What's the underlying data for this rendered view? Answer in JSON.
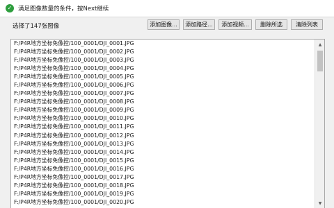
{
  "status": {
    "icon": "check-circle-icon",
    "text": "满足图像数量的条件，按Next继续"
  },
  "panel": {
    "count_label": "选择了147张图像",
    "buttons": {
      "add_images": "添加图像...",
      "add_path": "添加路径...",
      "add_video": "添加视频...",
      "remove_selected": "删除所选",
      "clear_list": "清除列表"
    },
    "file_list": [
      "F:/P4R地方坐标免像控/100_0001/DJI_0001.JPG",
      "F:/P4R地方坐标免像控/100_0001/DJI_0002.JPG",
      "F:/P4R地方坐标免像控/100_0001/DJI_0003.JPG",
      "F:/P4R地方坐标免像控/100_0001/DJI_0004.JPG",
      "F:/P4R地方坐标免像控/100_0001/DJI_0005.JPG",
      "F:/P4R地方坐标免像控/100_0001/DJI_0006.JPG",
      "F:/P4R地方坐标免像控/100_0001/DJI_0007.JPG",
      "F:/P4R地方坐标免像控/100_0001/DJI_0008.JPG",
      "F:/P4R地方坐标免像控/100_0001/DJI_0009.JPG",
      "F:/P4R地方坐标免像控/100_0001/DJI_0010.JPG",
      "F:/P4R地方坐标免像控/100_0001/DJI_0011.JPG",
      "F:/P4R地方坐标免像控/100_0001/DJI_0012.JPG",
      "F:/P4R地方坐标免像控/100_0001/DJI_0013.JPG",
      "F:/P4R地方坐标免像控/100_0001/DJI_0014.JPG",
      "F:/P4R地方坐标免像控/100_0001/DJI_0015.JPG",
      "F:/P4R地方坐标免像控/100_0001/DJI_0016.JPG",
      "F:/P4R地方坐标免像控/100_0001/DJI_0017.JPG",
      "F:/P4R地方坐标免像控/100_0001/DJI_0018.JPG",
      "F:/P4R地方坐标免像控/100_0001/DJI_0019.JPG",
      "F:/P4R地方坐标免像控/100_0001/DJI_0020.JPG"
    ]
  }
}
